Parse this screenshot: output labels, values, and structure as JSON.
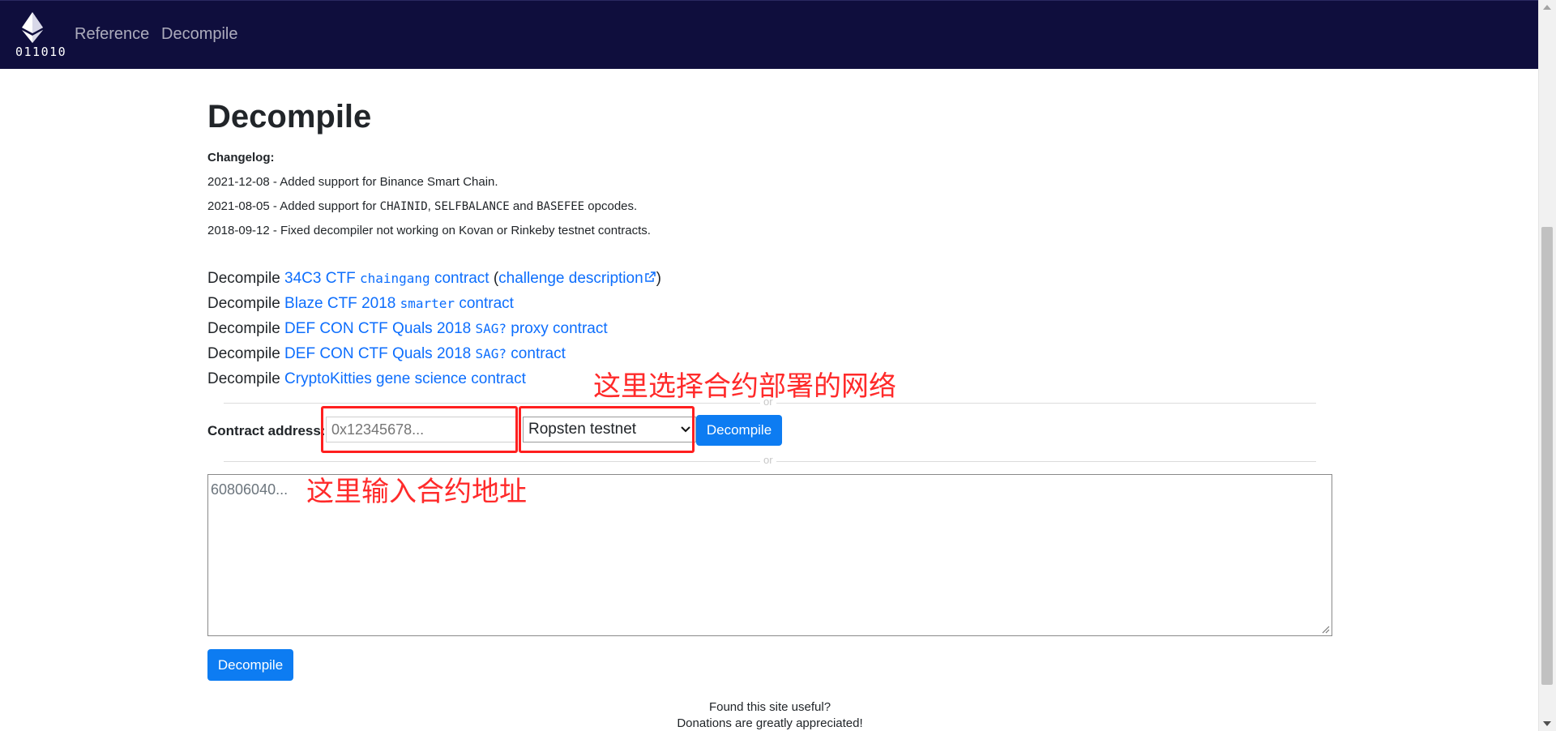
{
  "nav": {
    "brand_text": "011010",
    "links": [
      "Reference",
      "Decompile"
    ]
  },
  "page": {
    "title": "Decompile",
    "changelog_label": "Changelog:",
    "changelog": [
      {
        "prefix": "2021-12-08 - Added support for Binance Smart Chain.",
        "codes": []
      },
      {
        "prefix": "2021-08-05 - Added support for ",
        "codes": [
          "CHAINID",
          "SELFBALANCE",
          "BASEFEE"
        ],
        "sep1": ", ",
        "sep2": " and ",
        "suffix": " opcodes."
      },
      {
        "prefix": "2018-09-12 - Fixed decompiler not working on Kovan or Rinkeby testnet contracts.",
        "codes": []
      }
    ],
    "examples": [
      {
        "lead": "Decompile ",
        "link_a": "34C3 CTF ",
        "code": "chaingang",
        "link_b": " contract",
        "extra_open": " (",
        "extra_link": "challenge description",
        "extra_close": ")"
      },
      {
        "lead": "Decompile ",
        "link_a": "Blaze CTF 2018 ",
        "code": "smarter",
        "link_b": " contract"
      },
      {
        "lead": "Decompile ",
        "link_a": "DEF CON CTF Quals 2018 ",
        "code": "SAG?",
        "link_b": " proxy contract"
      },
      {
        "lead": "Decompile ",
        "link_a": "DEF CON CTF Quals 2018 ",
        "code": "SAG?",
        "link_b": " contract"
      },
      {
        "lead": "Decompile ",
        "link_a": "CryptoKitties gene science contract"
      }
    ],
    "or_label": "or",
    "address_label": "Contract address:",
    "address_placeholder": "0x12345678...",
    "network_selected": "Ropsten testnet",
    "decompile_button": "Decompile",
    "bytecode_placeholder": "60806040...",
    "footer": [
      "Found this site useful?",
      "Donations are greatly appreciated!"
    ]
  },
  "annotations": {
    "network_note": "这里选择合约部署的网络",
    "address_note": "这里输入合约地址",
    "color": "#ff1f1f"
  },
  "colors": {
    "navbar_bg": "#0f0e3d",
    "link": "#0d6efd",
    "button": "#0d7cf2"
  }
}
